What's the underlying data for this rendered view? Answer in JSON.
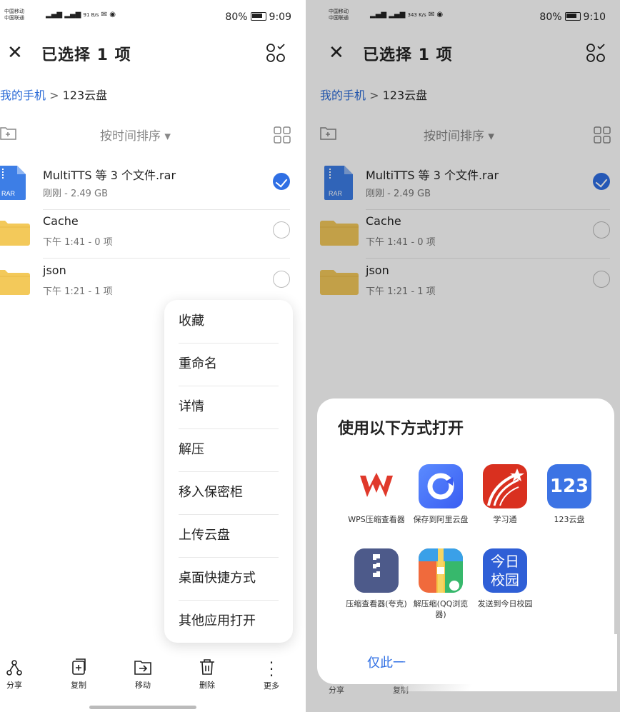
{
  "left": {
    "status": {
      "carrier1": "中国移动",
      "carrier2": "中国联通",
      "speed": "91 B/s",
      "battery": "80%",
      "time": "9:09"
    },
    "title": "已选择 1 项",
    "breadcrumb": {
      "root": "我的手机",
      "sep": ">",
      "current": "123云盘"
    },
    "sort_label": "按时间排序 ▾",
    "files": [
      {
        "name": "MultiTTS 等 3 个文件.rar",
        "meta": "刚刚 - 2.49 GB",
        "type_label": "RAR",
        "checked": true
      },
      {
        "name": "Cache",
        "meta": "下午 1:41 - 0 项",
        "checked": false
      },
      {
        "name": "json",
        "meta": "下午 1:21 - 1 项",
        "checked": false
      }
    ],
    "menu": [
      "收藏",
      "重命名",
      "详情",
      "解压",
      "移入保密柜",
      "上传云盘",
      "桌面快捷方式",
      "其他应用打开"
    ],
    "bottom": [
      {
        "label": "分享",
        "icon": "share-icon"
      },
      {
        "label": "复制",
        "icon": "copy-icon"
      },
      {
        "label": "移动",
        "icon": "move-icon"
      },
      {
        "label": "删除",
        "icon": "trash-icon"
      },
      {
        "label": "更多",
        "icon": "more-icon"
      }
    ]
  },
  "right": {
    "status": {
      "carrier1": "中国移动",
      "carrier2": "中国联通",
      "speed": "343 K/s",
      "battery": "80%",
      "time": "9:10"
    },
    "title": "已选择 1 项",
    "breadcrumb": {
      "root": "我的手机",
      "sep": ">",
      "current": "123云盘"
    },
    "sort_label": "按时间排序 ▾",
    "files": [
      {
        "name": "MultiTTS 等 3 个文件.rar",
        "meta": "刚刚 - 2.49 GB",
        "type_label": "RAR",
        "checked": true
      },
      {
        "name": "Cache",
        "meta": "下午 1:41 - 0 项",
        "checked": false
      },
      {
        "name": "json",
        "meta": "下午 1:21 - 1 项",
        "checked": false
      }
    ],
    "sheet_title": "使用以下方式打开",
    "apps": [
      {
        "label": "WPS压缩查看器",
        "icon": "wps-icon"
      },
      {
        "label": "保存到阿里云盘",
        "icon": "aliyun-icon"
      },
      {
        "label": "学习通",
        "icon": "xuexitong-icon"
      },
      {
        "label": "123云盘",
        "icon": "123pan-icon",
        "glyph": "123"
      },
      {
        "label": "压缩查看器(夸克)",
        "icon": "quark-zip-icon"
      },
      {
        "label": "解压缩(QQ浏览器)",
        "icon": "qq-unzip-icon"
      },
      {
        "label": "发送到今日校园",
        "icon": "jinri-icon",
        "glyph": "今日校园"
      }
    ],
    "once_label": "仅此一",
    "ghost_bottom": [
      "分享",
      "复制"
    ]
  },
  "colors": {
    "accent": "#2f6fe4",
    "link": "#2a6ad6",
    "folder": "#f3c95a",
    "rar": "#3d7ee6"
  }
}
